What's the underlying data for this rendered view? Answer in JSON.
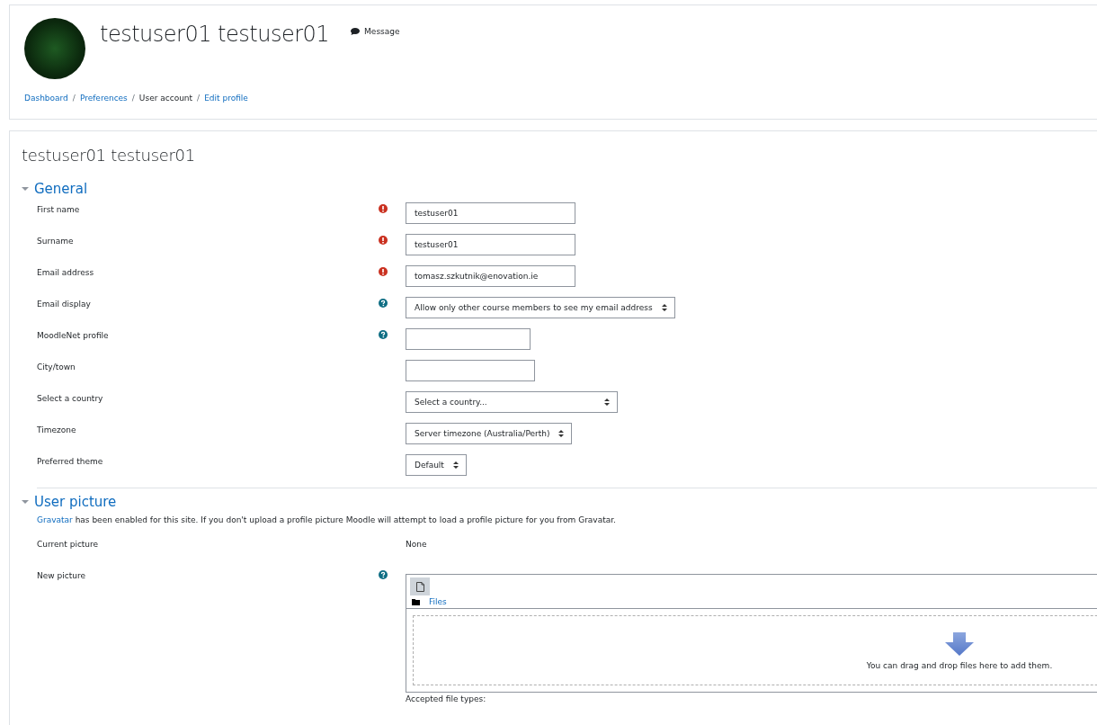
{
  "header": {
    "name": "testuser01 testuser01",
    "message": "Message",
    "breadcrumbs": [
      {
        "label": "Dashboard",
        "link": true
      },
      {
        "label": "Preferences",
        "link": true
      },
      {
        "label": "User account",
        "link": false
      },
      {
        "label": "Edit profile",
        "link": true
      }
    ],
    "separator": "/"
  },
  "page_title": "testuser01 testuser01",
  "sections": [
    {
      "title": "General",
      "expanded": true,
      "fields": [
        {
          "label": "First name",
          "required": true,
          "help": false,
          "kind": "text",
          "value": "testuser01"
        },
        {
          "label": "Surname",
          "required": true,
          "help": false,
          "kind": "text",
          "value": "testuser01"
        },
        {
          "label": "Email address",
          "required": true,
          "help": false,
          "kind": "text",
          "value": "tomasz.szkutnik@enovation.ie"
        },
        {
          "label": "Email display",
          "required": false,
          "help": true,
          "kind": "select",
          "value": "Allow only other course members to see my email address"
        },
        {
          "label": "MoodleNet profile",
          "required": false,
          "help": true,
          "kind": "text"
        },
        {
          "label": "City/town",
          "required": false,
          "help": false,
          "kind": "text"
        },
        {
          "label": "Select a country",
          "required": false,
          "help": false,
          "kind": "select",
          "value": "Select a country..."
        },
        {
          "label": "Timezone",
          "required": false,
          "help": false,
          "kind": "select",
          "value": "Server timezone (Australia/Perth)"
        },
        {
          "label": "Preferred theme",
          "required": false,
          "help": false,
          "kind": "select",
          "value": "Default"
        }
      ]
    },
    {
      "title": "User picture",
      "expanded": true,
      "intro": {
        "link": "Gravatar",
        "text": " has been enabled for this site. If you don't upload a profile picture Moodle will attempt to load a profile picture for you from Gravatar."
      },
      "fields": [
        {
          "label": "Current picture",
          "required": false,
          "help": false,
          "kind": "static",
          "value": "None"
        },
        {
          "label": "New picture",
          "required": false,
          "help": true,
          "kind": "filepicker",
          "folder": "Files",
          "drop_hint": "You can drag and drop files here to add them.",
          "accepted": "Accepted file types:"
        }
      ]
    }
  ]
}
